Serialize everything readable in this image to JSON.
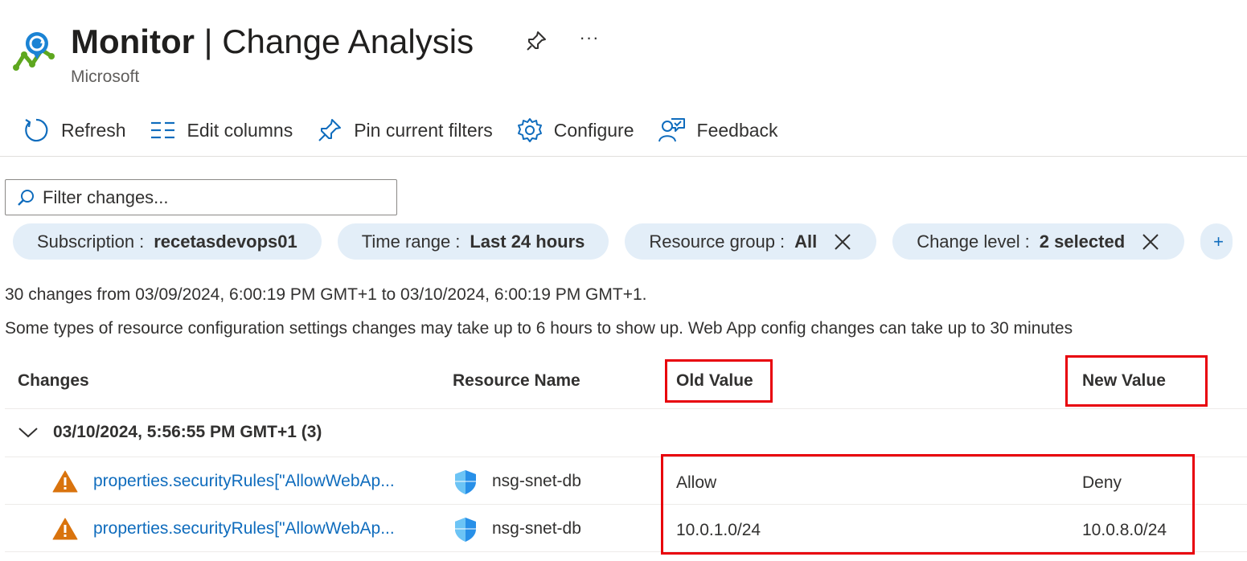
{
  "header": {
    "title_bold": "Monitor",
    "title_rest": " | Change Analysis",
    "subtitle": "Microsoft",
    "more_label": "···"
  },
  "toolbar": {
    "refresh": "Refresh",
    "edit_columns": "Edit columns",
    "pin_filters": "Pin current filters",
    "configure": "Configure",
    "feedback": "Feedback"
  },
  "filter": {
    "placeholder": "Filter changes..."
  },
  "pills": [
    {
      "key": "Subscription",
      "value": "recetasdevops01"
    },
    {
      "key": "Time range",
      "value": "Last 24 hours"
    },
    {
      "key": "Resource group",
      "value": "All"
    },
    {
      "key": "Change level",
      "value": "2 selected"
    }
  ],
  "pill_sep": ":",
  "add_pill": "+",
  "summary": {
    "line1": "30 changes from 03/09/2024, 6:00:19 PM GMT+1 to 03/10/2024, 6:00:19 PM GMT+1.",
    "line2": "Some types of resource configuration settings changes may take up to 6 hours to show up. Web App config changes can take up to 30 minutes"
  },
  "table": {
    "columns": [
      "Changes",
      "Resource Name",
      "Old Value",
      "New Value"
    ],
    "group_label": "03/10/2024, 5:56:55 PM GMT+1 (3)",
    "rows": [
      {
        "change": "properties.securityRules[\"AllowWebAp...",
        "resource": "nsg-snet-db",
        "old": "Allow",
        "new": "Deny"
      },
      {
        "change": "properties.securityRules[\"AllowWebAp...",
        "resource": "nsg-snet-db",
        "old": "10.0.1.0/24",
        "new": "10.0.8.0/24"
      }
    ]
  },
  "colors": {
    "accent": "#0f6cbd",
    "pill_bg": "#e3eef8",
    "warning": "#d9730d",
    "highlight": "#e8000b"
  },
  "icons": {
    "app": "change-analysis-icon",
    "pin": "pin-icon",
    "refresh": "refresh-icon",
    "edit_columns": "columns-icon",
    "pin_filters": "pin-icon",
    "configure": "gear-icon",
    "feedback": "feedback-icon",
    "search": "search-icon",
    "close": "close-icon",
    "chevron": "chevron-down-icon",
    "warning": "warning-icon",
    "nsg": "shield-icon"
  }
}
